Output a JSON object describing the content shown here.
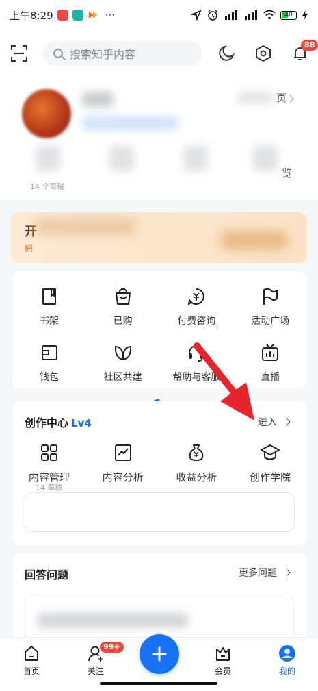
{
  "status_bar": {
    "time": "上午8:29",
    "battery": "40",
    "more": "···"
  },
  "topbar": {
    "search_placeholder": "搜索知乎内容",
    "notification_badge": "88"
  },
  "profile": {
    "drafts": "14 个草稿",
    "partial_right_1": "页",
    "partial_right_2": "览"
  },
  "vip_banner": {
    "char_1": "开",
    "char_2": "帜"
  },
  "services": {
    "items": [
      {
        "label": "书架",
        "icon": "bookshelf-icon"
      },
      {
        "label": "已购",
        "icon": "bag-icon"
      },
      {
        "label": "付费咨询",
        "icon": "paid-consult-icon"
      },
      {
        "label": "活动广场",
        "icon": "flag-icon"
      },
      {
        "label": "钱包",
        "icon": "wallet-icon"
      },
      {
        "label": "社区共建",
        "icon": "leaves-icon"
      },
      {
        "label": "帮助与客服",
        "icon": "headset-icon"
      },
      {
        "label": "直播",
        "icon": "tv-icon"
      }
    ]
  },
  "creator_center": {
    "title": "创作中心",
    "level": "Lv4",
    "enter": "进入",
    "drafts": "14 草稿",
    "items": [
      {
        "label": "内容管理",
        "icon": "grid-icon"
      },
      {
        "label": "内容分析",
        "icon": "chart-icon"
      },
      {
        "label": "收益分析",
        "icon": "moneybag-icon"
      },
      {
        "label": "创作学院",
        "icon": "graduation-cap-icon"
      }
    ]
  },
  "answer": {
    "title": "回答问题",
    "more": "更多问题"
  },
  "bottom_nav": {
    "home": "首页",
    "follow": "关注",
    "follow_badge": "99+",
    "member": "会员",
    "mine": "我的"
  },
  "colors": {
    "accent": "#1772f6",
    "badge": "#f0463c",
    "arrow": "#e8232a"
  }
}
